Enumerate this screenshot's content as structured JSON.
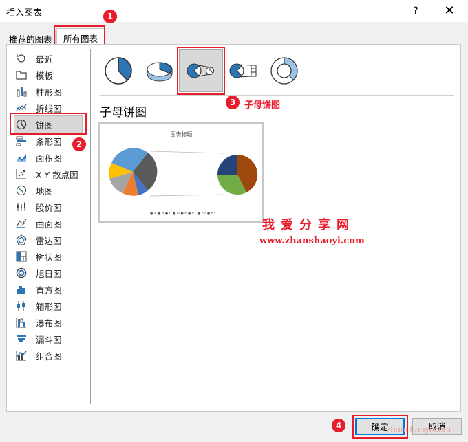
{
  "window": {
    "title": "插入图表",
    "help": "?",
    "close": "✕"
  },
  "tabs": [
    {
      "label": "推荐的图表"
    },
    {
      "label": "所有图表"
    }
  ],
  "sidebar": {
    "items": [
      {
        "label": "最近",
        "icon": "recent-icon"
      },
      {
        "label": "模板",
        "icon": "template-icon"
      },
      {
        "label": "柱形图",
        "icon": "column-chart-icon"
      },
      {
        "label": "折线图",
        "icon": "line-chart-icon"
      },
      {
        "label": "饼图",
        "icon": "pie-chart-icon",
        "selected": true
      },
      {
        "label": "条形图",
        "icon": "bar-chart-icon"
      },
      {
        "label": "面积图",
        "icon": "area-chart-icon"
      },
      {
        "label": "X Y 散点图",
        "icon": "scatter-chart-icon"
      },
      {
        "label": "地图",
        "icon": "map-chart-icon"
      },
      {
        "label": "股价图",
        "icon": "stock-chart-icon"
      },
      {
        "label": "曲面图",
        "icon": "surface-chart-icon"
      },
      {
        "label": "雷达图",
        "icon": "radar-chart-icon"
      },
      {
        "label": "树状图",
        "icon": "treemap-chart-icon"
      },
      {
        "label": "旭日图",
        "icon": "sunburst-chart-icon"
      },
      {
        "label": "直方图",
        "icon": "histogram-chart-icon"
      },
      {
        "label": "箱形图",
        "icon": "boxwhisker-chart-icon"
      },
      {
        "label": "瀑布图",
        "icon": "waterfall-chart-icon"
      },
      {
        "label": "漏斗图",
        "icon": "funnel-chart-icon"
      },
      {
        "label": "组合图",
        "icon": "combo-chart-icon"
      }
    ]
  },
  "main": {
    "section_title": "子母饼图",
    "preview": {
      "title": "图表标题",
      "legend": "● A   ● B   ● C   ● D   ● E   ● E1   ● E2   ● E3"
    }
  },
  "annotations": {
    "badges": [
      "1",
      "2",
      "3",
      "4"
    ],
    "note3": "子母饼图"
  },
  "watermark": {
    "line1": "我爱分享网",
    "line2": "www.zhanshaoyi.com",
    "corner": "zhanshaoyi.com"
  },
  "buttons": {
    "ok": "确定",
    "cancel": "取消"
  },
  "colors": {
    "accent_red": "#e81c2a",
    "focus_blue": "#0078d7",
    "chart_blue": "#2e75b6"
  }
}
